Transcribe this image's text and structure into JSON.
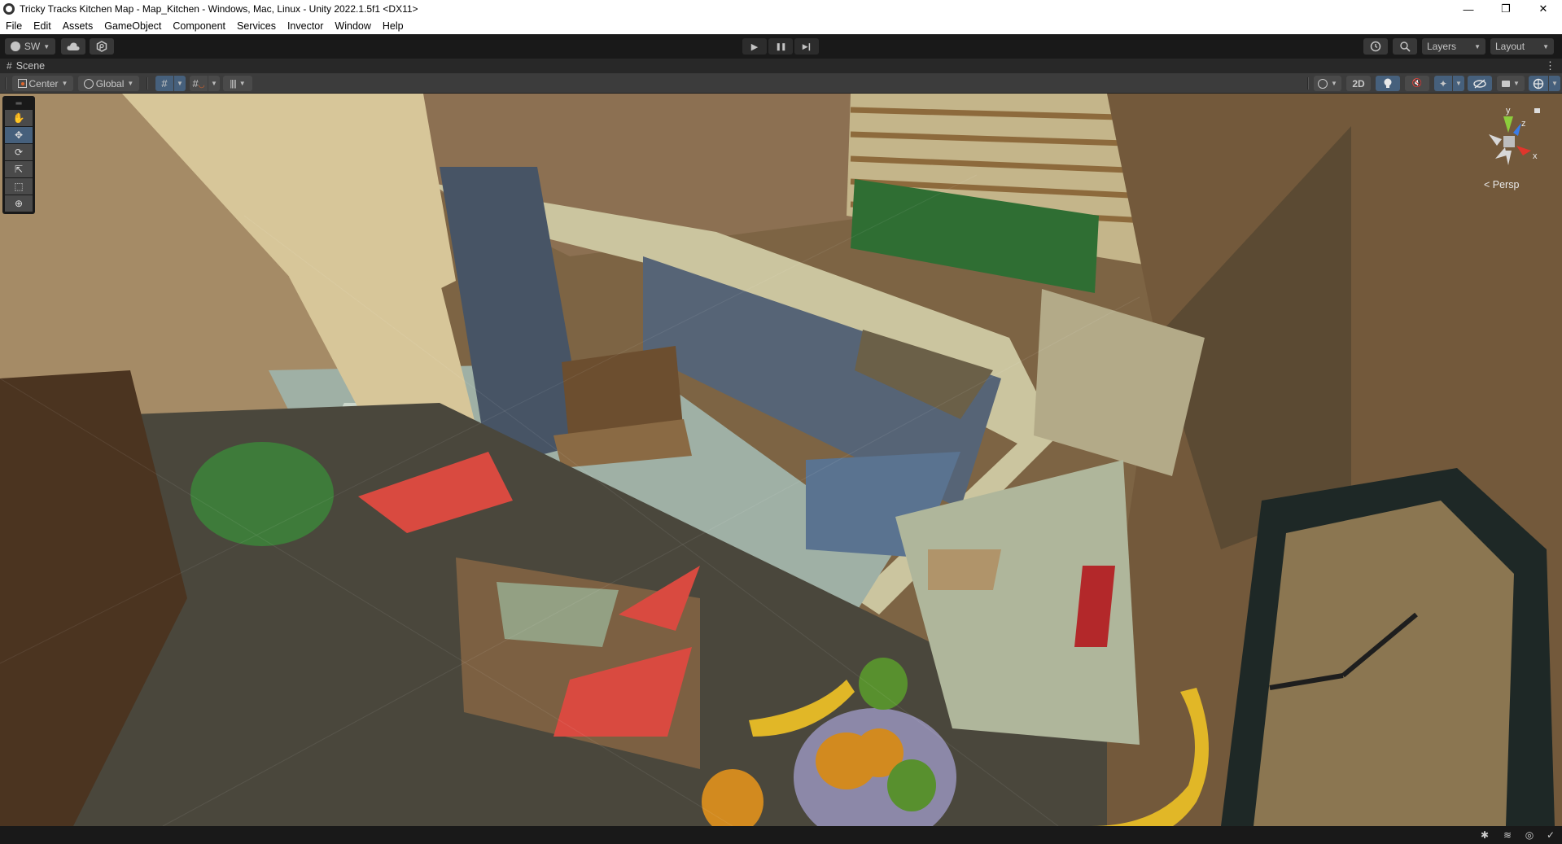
{
  "window": {
    "title": "Tricky Tracks Kitchen Map - Map_Kitchen - Windows, Mac, Linux - Unity 2022.1.5f1 <DX11>",
    "controls": {
      "minimize": "—",
      "restore": "❐",
      "close": "✕"
    }
  },
  "menu": [
    "File",
    "Edit",
    "Assets",
    "GameObject",
    "Component",
    "Services",
    "Invector",
    "Window",
    "Help"
  ],
  "toolbar": {
    "account_label": "SW",
    "cloud_icon": "cloud-icon",
    "collab_icon": "plastic-scm-icon",
    "play_icon": "▶",
    "pause_icon": "❚❚",
    "step_icon": "▶❙",
    "history_icon": "undo-history-icon",
    "search_icon": "search-icon",
    "layers_label": "Layers",
    "layout_label": "Layout"
  },
  "scene_tab": {
    "label": "Scene",
    "icon": "#"
  },
  "scene_toolbar": {
    "pivot_label": "Center",
    "space_label": "Global",
    "grid_snap_icon": "grid-snap-icon",
    "increment_snap_icon": "increment-snap-icon",
    "ruler_icon": "ruler-icon",
    "draw_mode_icon": "shading-mode-icon",
    "mode_2d_label": "2D",
    "lighting_icon": "lighting-icon",
    "audio_icon": "audio-mute-icon",
    "effects_icon": "effects-icon",
    "visibility_icon": "scene-visibility-icon",
    "camera_icon": "camera-icon",
    "gizmos_icon": "gizmos-icon"
  },
  "tools": [
    {
      "name": "hand-tool",
      "glyph": "✋",
      "active": false
    },
    {
      "name": "move-tool",
      "glyph": "✥",
      "active": true
    },
    {
      "name": "rotate-tool",
      "glyph": "⟳",
      "active": false
    },
    {
      "name": "scale-tool",
      "glyph": "⇱",
      "active": false
    },
    {
      "name": "rect-tool",
      "glyph": "⬚",
      "active": false
    },
    {
      "name": "transform-tool",
      "glyph": "⊕",
      "active": false
    }
  ],
  "gizmo": {
    "x_label": "x",
    "y_label": "y",
    "z_label": "z",
    "projection_label": "< Persp"
  },
  "status_icons": [
    "debug-icon",
    "cache-server-icon",
    "auto-generate-lighting-icon",
    "progress-check-icon"
  ],
  "colors": {
    "accent_blue": "#46607c",
    "axis_x": "#e0362c",
    "axis_y": "#8ccd3c",
    "axis_z": "#3a7ce8"
  }
}
